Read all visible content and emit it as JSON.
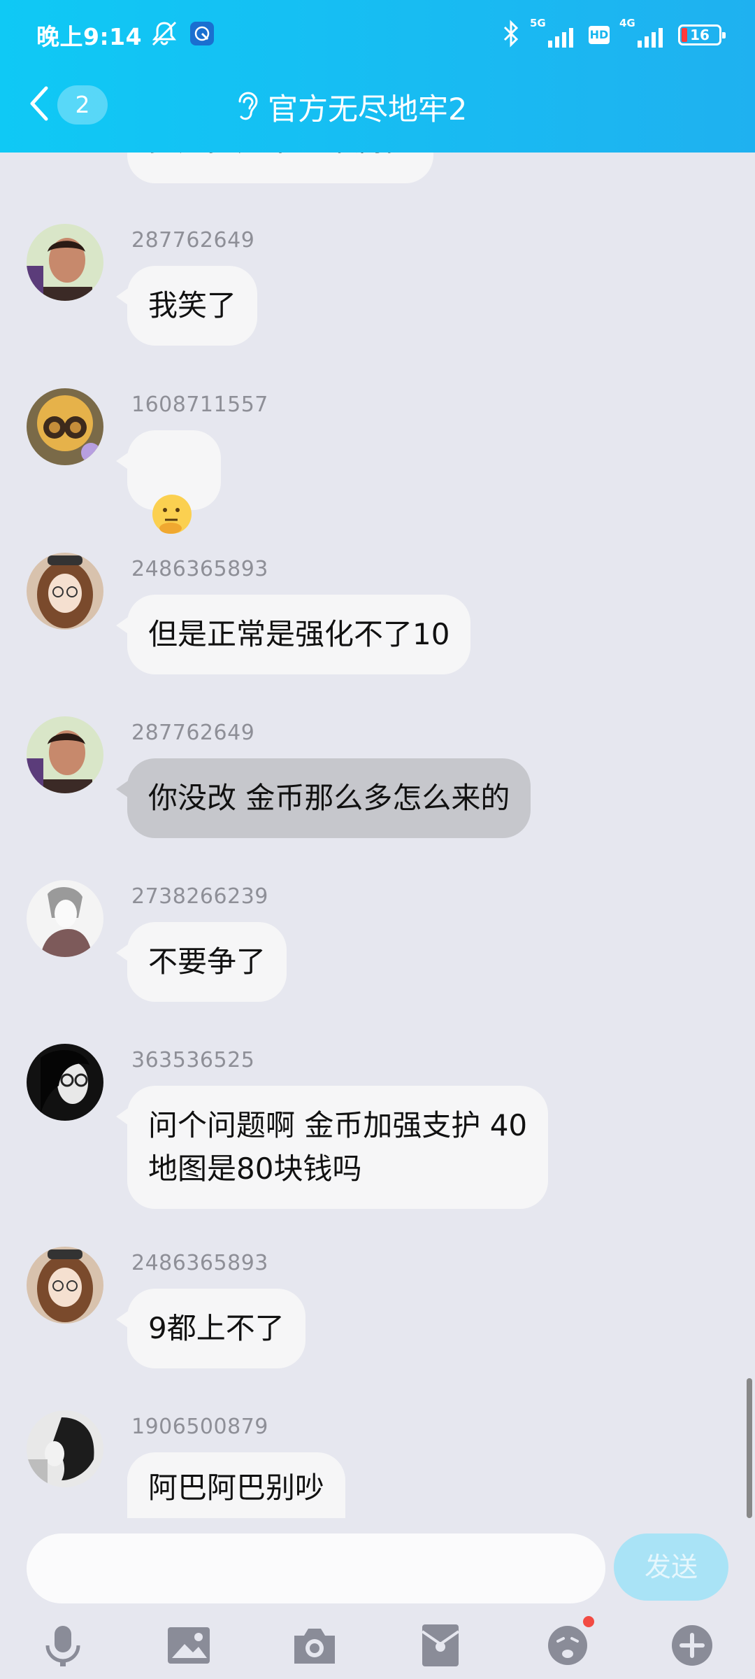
{
  "status": {
    "time": "晚上9:14",
    "sig1_label": "5G",
    "sig2_label": "4G",
    "hd": "HD",
    "battery": "16",
    "battery_level": 0.16
  },
  "nav": {
    "unread_count": "2",
    "title": "官方无尽地牢2"
  },
  "messages": [
    {
      "sender": "287762649",
      "text": "我笑了",
      "bubble_color": "#f6f6f7"
    },
    {
      "sender": "1608711557",
      "text": "",
      "sticker": "thinking-emoji"
    },
    {
      "sender": "2486365893",
      "text": "但是正常是强化不了10",
      "bubble_color": "#f6f6f7"
    },
    {
      "sender": "287762649",
      "text": "你没改 金币那么多怎么来的",
      "bubble_color": "#c6c7cc"
    },
    {
      "sender": "2738266239",
      "text": "不要争了",
      "bubble_color": "#f6f6f7"
    },
    {
      "sender": "363536525",
      "text": "问个问题啊  金币加强支护 40\n地图是80块钱吗",
      "bubble_color": "#f6f6f7"
    },
    {
      "sender": "2486365893",
      "text": "9都上不了",
      "bubble_color": "#f6f6f7"
    },
    {
      "sender": "1906500879",
      "text": "阿巴阿巴别吵",
      "bubble_color": "#f6f6f7"
    }
  ],
  "partial_top_message": "多几把充不正常属性",
  "input": {
    "placeholder": "",
    "send_label": "发送"
  },
  "colors": {
    "header_start": "#0fc9f5",
    "header_end": "#1fb1f0",
    "background": "#e6e7ef",
    "send_disabled": "#a9e3f6",
    "icon_grey": "#8a8c98"
  },
  "toolbar_icons": [
    "microphone-icon",
    "image-icon",
    "camera-icon",
    "red-packet-icon",
    "emoji-icon",
    "plus-icon"
  ]
}
